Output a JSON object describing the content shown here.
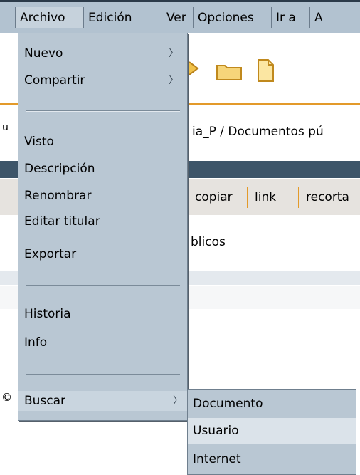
{
  "menubar": {
    "items": [
      "Archivo",
      "Edición",
      "Ver",
      "Opciones",
      "Ir a",
      "A"
    ]
  },
  "background": {
    "path_prefix": "u",
    "path_text": "ia_P / Documentos pú",
    "actions": [
      "copiar",
      "link",
      "recorta"
    ],
    "folder_prefix": "",
    "folder_text": "blicos",
    "left_edge_char": "©"
  },
  "menu": {
    "nuevo": "Nuevo",
    "compartir": "Compartir",
    "visto": "Visto",
    "descripcion": "Descripción",
    "renombrar": "Renombrar",
    "editar_titular": "Editar titular",
    "exportar": "Exportar",
    "historia": "Historia",
    "info": "Info",
    "buscar": "Buscar"
  },
  "submenu": {
    "items": [
      "Documento",
      "Usuario",
      "Internet"
    ]
  },
  "icons": {
    "submenu_arrow": "chevron-right-icon",
    "toolbar": [
      "forward-arrow-icon",
      "folder-icon",
      "document-icon"
    ]
  },
  "colors": {
    "menu_bg": "#b9c7d3",
    "menubar_bg": "#b2c2d0",
    "accent_orange": "#e39a2a",
    "title_blue": "#3d5569"
  }
}
